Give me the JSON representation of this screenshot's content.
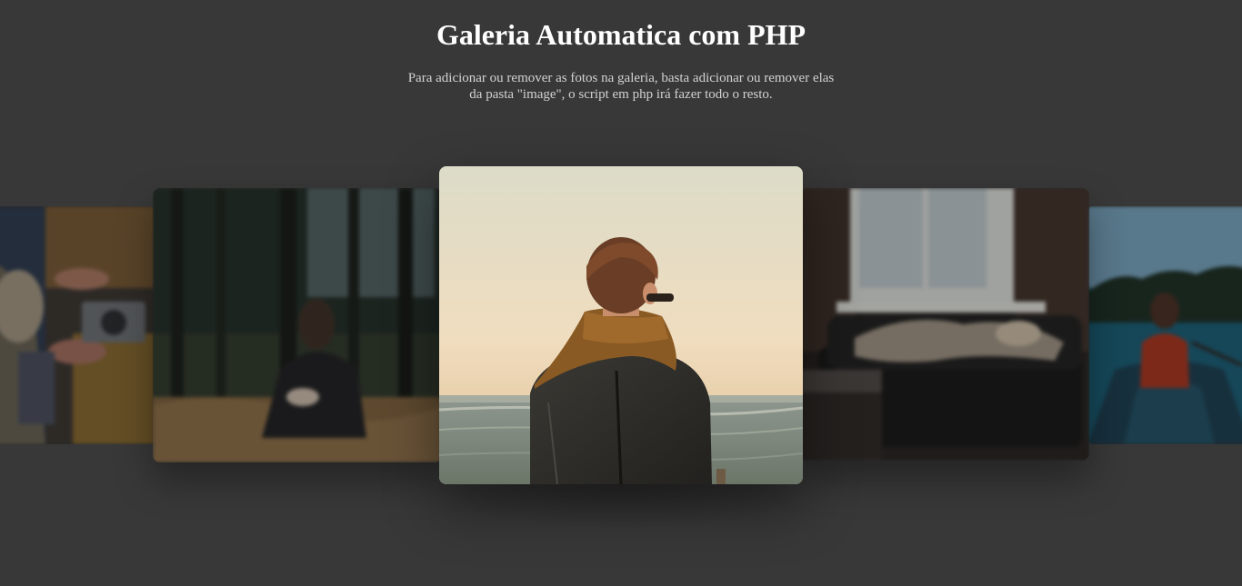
{
  "header": {
    "title": "Galeria Automatica com PHP",
    "description_line1": "Para adicionar ou remover as fotos na galeria, basta adicionar ou remover elas",
    "description_line2": "da pasta \"image\", o script em php irá fazer todo o resto."
  },
  "colors": {
    "background": "#383838",
    "title": "#ffffff",
    "description": "#d2d2d2"
  },
  "gallery": {
    "slides": [
      {
        "name": "camera-hands-photo",
        "position": "far-left"
      },
      {
        "name": "forest-girl-photo",
        "position": "left"
      },
      {
        "name": "scarf-man-sea-photo",
        "position": "center",
        "active": true
      },
      {
        "name": "sleeping-couch-photo",
        "position": "right"
      },
      {
        "name": "canoe-lake-photo",
        "position": "far-right"
      }
    ]
  }
}
